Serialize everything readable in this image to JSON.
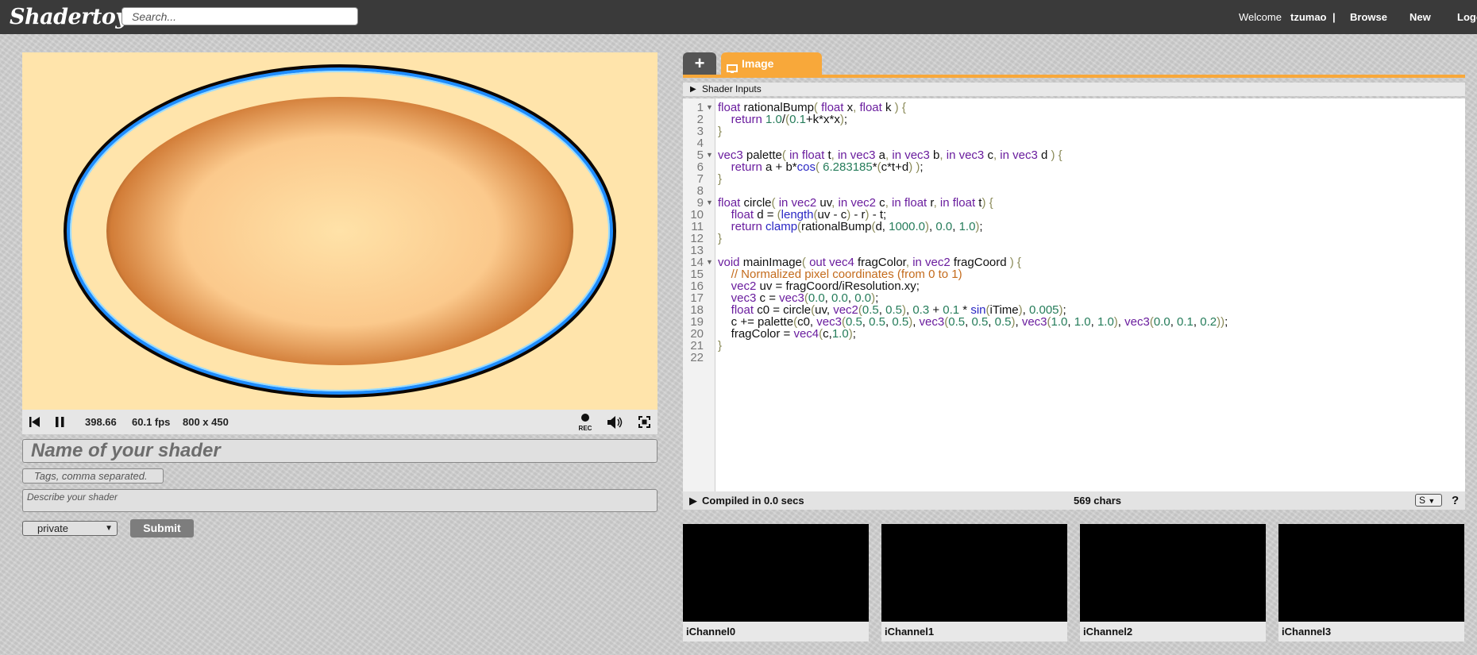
{
  "header": {
    "logo": "Shadertoy",
    "search_placeholder": "Search...",
    "welcome": "Welcome",
    "username": "tzumao",
    "separator": "|",
    "browse": "Browse",
    "new": "New",
    "login_cut": "Logo"
  },
  "player": {
    "time": "398.66",
    "fps": "60.1 fps",
    "resolution": "800 x 450",
    "rec_label": "REC"
  },
  "form": {
    "name_placeholder": "Name of your shader",
    "tags_placeholder": "Tags, comma separated.",
    "description_placeholder": "Describe your shader",
    "privacy_selected": "private",
    "submit_label": "Submit"
  },
  "editor": {
    "add_tab_label": "+",
    "image_tab_label": "Image",
    "shader_inputs_label": "Shader Inputs",
    "line_numbers": [
      "1",
      "2",
      "3",
      "4",
      "5",
      "6",
      "7",
      "8",
      "9",
      "10",
      "11",
      "12",
      "13",
      "14",
      "15",
      "16",
      "17",
      "18",
      "19",
      "20",
      "21",
      "22"
    ],
    "fold_lines": [
      1,
      5,
      9,
      14
    ],
    "lines": [
      [
        [
          "kw",
          "float"
        ],
        [
          "id",
          " rationalBump"
        ],
        [
          "pn",
          "( "
        ],
        [
          "kw",
          "float"
        ],
        [
          "id",
          " x"
        ],
        [
          "pn",
          ", "
        ],
        [
          "kw",
          "float"
        ],
        [
          "id",
          " k"
        ],
        [
          "pn",
          " ) {"
        ]
      ],
      [
        [
          "id",
          "    "
        ],
        [
          "kw",
          "return"
        ],
        [
          "id",
          " "
        ],
        [
          "num",
          "1.0"
        ],
        [
          "id",
          "/"
        ],
        [
          "pn",
          "("
        ],
        [
          "num",
          "0.1"
        ],
        [
          "id",
          "+k*x*x"
        ],
        [
          "pn",
          ")"
        ],
        [
          "id",
          ";"
        ]
      ],
      [
        [
          "pn",
          "}"
        ]
      ],
      [],
      [
        [
          "kw",
          "vec3"
        ],
        [
          "id",
          " palette"
        ],
        [
          "pn",
          "( "
        ],
        [
          "kw",
          "in float"
        ],
        [
          "id",
          " t"
        ],
        [
          "pn",
          ", "
        ],
        [
          "kw",
          "in vec3"
        ],
        [
          "id",
          " a"
        ],
        [
          "pn",
          ", "
        ],
        [
          "kw",
          "in vec3"
        ],
        [
          "id",
          " b"
        ],
        [
          "pn",
          ", "
        ],
        [
          "kw",
          "in vec3"
        ],
        [
          "id",
          " c"
        ],
        [
          "pn",
          ", "
        ],
        [
          "kw",
          "in vec3"
        ],
        [
          "id",
          " d"
        ],
        [
          "pn",
          " ) {"
        ]
      ],
      [
        [
          "id",
          "    "
        ],
        [
          "kw",
          "return"
        ],
        [
          "id",
          " a + b*"
        ],
        [
          "fn",
          "cos"
        ],
        [
          "pn",
          "( "
        ],
        [
          "num",
          "6.283185"
        ],
        [
          "id",
          "*"
        ],
        [
          "pn",
          "("
        ],
        [
          "id",
          "c*t+d"
        ],
        [
          "pn",
          ")"
        ],
        [
          "pn",
          " )"
        ],
        [
          "id",
          ";"
        ]
      ],
      [
        [
          "pn",
          "}"
        ]
      ],
      [],
      [
        [
          "kw",
          "float"
        ],
        [
          "id",
          " circle"
        ],
        [
          "pn",
          "( "
        ],
        [
          "kw",
          "in vec2"
        ],
        [
          "id",
          " uv"
        ],
        [
          "pn",
          ", "
        ],
        [
          "kw",
          "in vec2"
        ],
        [
          "id",
          " c"
        ],
        [
          "pn",
          ", "
        ],
        [
          "kw",
          "in float"
        ],
        [
          "id",
          " r"
        ],
        [
          "pn",
          ", "
        ],
        [
          "kw",
          "in float"
        ],
        [
          "id",
          " t"
        ],
        [
          "pn",
          ") {"
        ]
      ],
      [
        [
          "id",
          "    "
        ],
        [
          "kw",
          "float"
        ],
        [
          "id",
          " d = "
        ],
        [
          "pn",
          "("
        ],
        [
          "fn",
          "length"
        ],
        [
          "pn",
          "("
        ],
        [
          "id",
          "uv - c"
        ],
        [
          "pn",
          ")"
        ],
        [
          "id",
          " - r"
        ],
        [
          "pn",
          ")"
        ],
        [
          "id",
          " - t;"
        ]
      ],
      [
        [
          "id",
          "    "
        ],
        [
          "kw",
          "return"
        ],
        [
          "id",
          " "
        ],
        [
          "fn",
          "clamp"
        ],
        [
          "pn",
          "("
        ],
        [
          "id",
          "rationalBump"
        ],
        [
          "pn",
          "("
        ],
        [
          "id",
          "d, "
        ],
        [
          "num",
          "1000.0"
        ],
        [
          "pn",
          ")"
        ],
        [
          "id",
          ", "
        ],
        [
          "num",
          "0.0"
        ],
        [
          "id",
          ", "
        ],
        [
          "num",
          "1.0"
        ],
        [
          "pn",
          ")"
        ],
        [
          "id",
          ";"
        ]
      ],
      [
        [
          "pn",
          "}"
        ]
      ],
      [],
      [
        [
          "kw",
          "void"
        ],
        [
          "id",
          " mainImage"
        ],
        [
          "pn",
          "( "
        ],
        [
          "kw",
          "out vec4"
        ],
        [
          "id",
          " fragColor"
        ],
        [
          "pn",
          ", "
        ],
        [
          "kw",
          "in vec2"
        ],
        [
          "id",
          " fragCoord"
        ],
        [
          "pn",
          " ) {"
        ]
      ],
      [
        [
          "id",
          "    "
        ],
        [
          "cm",
          "// Normalized pixel coordinates (from 0 to 1)"
        ]
      ],
      [
        [
          "id",
          "    "
        ],
        [
          "kw",
          "vec2"
        ],
        [
          "id",
          " uv = fragCoord/iResolution.xy;"
        ]
      ],
      [
        [
          "id",
          "    "
        ],
        [
          "kw",
          "vec3"
        ],
        [
          "id",
          " c = "
        ],
        [
          "kw",
          "vec3"
        ],
        [
          "pn",
          "("
        ],
        [
          "num",
          "0.0"
        ],
        [
          "id",
          ", "
        ],
        [
          "num",
          "0.0"
        ],
        [
          "id",
          ", "
        ],
        [
          "num",
          "0.0"
        ],
        [
          "pn",
          ")"
        ],
        [
          "id",
          ";"
        ]
      ],
      [
        [
          "id",
          "    "
        ],
        [
          "kw",
          "float"
        ],
        [
          "id",
          " c0 = circle"
        ],
        [
          "pn",
          "("
        ],
        [
          "id",
          "uv, "
        ],
        [
          "kw",
          "vec2"
        ],
        [
          "pn",
          "("
        ],
        [
          "num",
          "0.5"
        ],
        [
          "id",
          ", "
        ],
        [
          "num",
          "0.5"
        ],
        [
          "pn",
          ")"
        ],
        [
          "id",
          ", "
        ],
        [
          "num",
          "0.3"
        ],
        [
          "id",
          " + "
        ],
        [
          "num",
          "0.1"
        ],
        [
          "id",
          " * "
        ],
        [
          "fn",
          "sin"
        ],
        [
          "pn",
          "("
        ],
        [
          "id",
          "iTime"
        ],
        [
          "pn",
          ")"
        ],
        [
          "id",
          ", "
        ],
        [
          "num",
          "0.005"
        ],
        [
          "pn",
          ")"
        ],
        [
          "id",
          ";"
        ]
      ],
      [
        [
          "id",
          "    c += palette"
        ],
        [
          "pn",
          "("
        ],
        [
          "id",
          "c0, "
        ],
        [
          "kw",
          "vec3"
        ],
        [
          "pn",
          "("
        ],
        [
          "num",
          "0.5"
        ],
        [
          "id",
          ", "
        ],
        [
          "num",
          "0.5"
        ],
        [
          "id",
          ", "
        ],
        [
          "num",
          "0.5"
        ],
        [
          "pn",
          ")"
        ],
        [
          "id",
          ", "
        ],
        [
          "kw",
          "vec3"
        ],
        [
          "pn",
          "("
        ],
        [
          "num",
          "0.5"
        ],
        [
          "id",
          ", "
        ],
        [
          "num",
          "0.5"
        ],
        [
          "id",
          ", "
        ],
        [
          "num",
          "0.5"
        ],
        [
          "pn",
          ")"
        ],
        [
          "id",
          ", "
        ],
        [
          "kw",
          "vec3"
        ],
        [
          "pn",
          "("
        ],
        [
          "num",
          "1.0"
        ],
        [
          "id",
          ", "
        ],
        [
          "num",
          "1.0"
        ],
        [
          "id",
          ", "
        ],
        [
          "num",
          "1.0"
        ],
        [
          "pn",
          ")"
        ],
        [
          "id",
          ", "
        ],
        [
          "kw",
          "vec3"
        ],
        [
          "pn",
          "("
        ],
        [
          "num",
          "0.0"
        ],
        [
          "id",
          ", "
        ],
        [
          "num",
          "0.1"
        ],
        [
          "id",
          ", "
        ],
        [
          "num",
          "0.2"
        ],
        [
          "pn",
          "))"
        ],
        [
          "id",
          ";"
        ]
      ],
      [
        [
          "id",
          "    fragColor = "
        ],
        [
          "kw",
          "vec4"
        ],
        [
          "pn",
          "("
        ],
        [
          "id",
          "c,"
        ],
        [
          "num",
          "1.0"
        ],
        [
          "pn",
          ")"
        ],
        [
          "id",
          ";"
        ]
      ],
      [
        [
          "pn",
          "}"
        ]
      ],
      []
    ],
    "status_compiled": "Compiled in 0.0 secs",
    "status_chars": "569 chars",
    "status_select": "S",
    "help_label": "?"
  },
  "channels": [
    {
      "label": "iChannel0"
    },
    {
      "label": "iChannel1"
    },
    {
      "label": "iChannel2"
    },
    {
      "label": "iChannel3"
    }
  ],
  "colors": {
    "accent": "#f8a83a",
    "topbar": "#3a3a3a",
    "ring_dark": "#0c0600",
    "ring_blue": "#1e8cff",
    "ring_light": "#ffe4ab",
    "ring_bg": "#ffe4ab"
  },
  "icons": [
    "skip-back-icon",
    "pause-icon",
    "record-icon",
    "volume-icon",
    "fullscreen-icon",
    "monitor-icon",
    "caret-right-icon",
    "chevron-down-icon"
  ]
}
